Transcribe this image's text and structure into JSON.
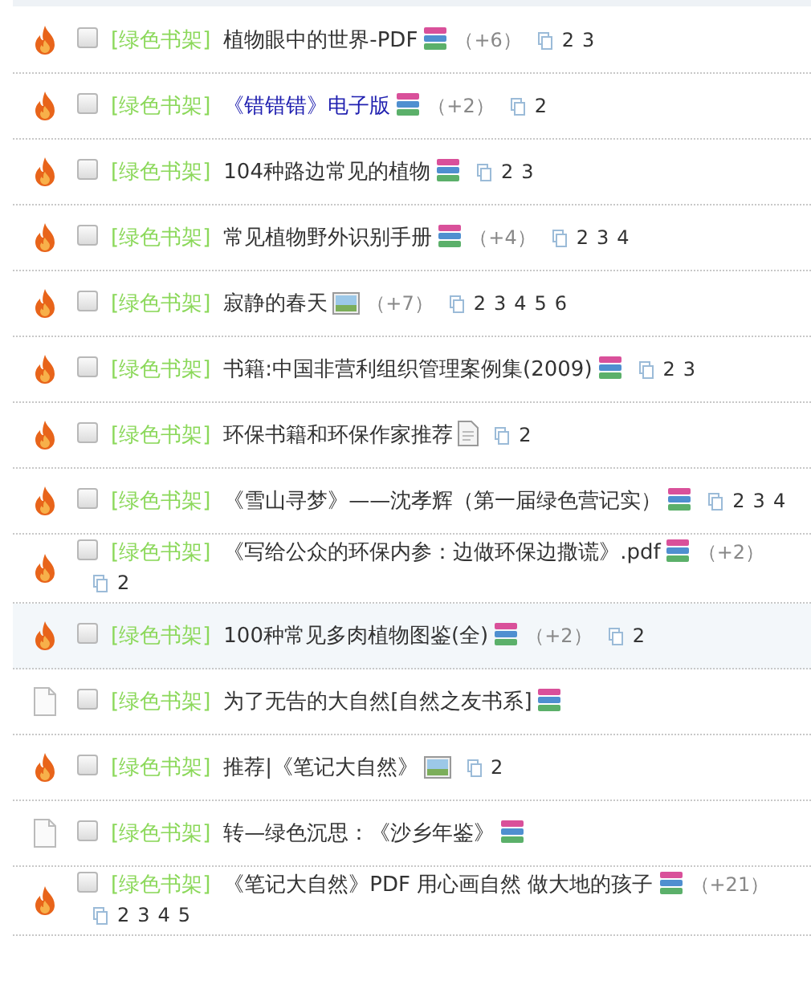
{
  "threads": [
    {
      "status": {
        "kind": "hot"
      },
      "checked": false,
      "category": "[绿色书架]",
      "title": "植物眼中的世界-PDF",
      "visited": false,
      "highlighted": false,
      "attachment": {
        "kind": "archive"
      },
      "extra": "（+6）",
      "pages": [
        "2",
        "3"
      ]
    },
    {
      "status": {
        "kind": "hot"
      },
      "checked": false,
      "category": "[绿色书架]",
      "title": "《错错错》电子版",
      "visited": true,
      "highlighted": false,
      "attachment": {
        "kind": "archive"
      },
      "extra": "（+2）",
      "pages": [
        "2"
      ]
    },
    {
      "status": {
        "kind": "hot"
      },
      "checked": false,
      "category": "[绿色书架]",
      "title": "104种路边常见的植物",
      "visited": false,
      "highlighted": false,
      "attachment": {
        "kind": "archive"
      },
      "pages": [
        "2",
        "3"
      ]
    },
    {
      "status": {
        "kind": "hot"
      },
      "checked": false,
      "category": "[绿色书架]",
      "title": "常见植物野外识别手册",
      "visited": false,
      "highlighted": false,
      "attachment": {
        "kind": "archive"
      },
      "extra": "（+4）",
      "pages": [
        "2",
        "3",
        "4"
      ]
    },
    {
      "status": {
        "kind": "hot"
      },
      "checked": false,
      "category": "[绿色书架]",
      "title": "寂静的春天",
      "visited": false,
      "highlighted": false,
      "attachment": {
        "kind": "image"
      },
      "extra": "（+7）",
      "pages": [
        "2",
        "3",
        "4",
        "5",
        "6"
      ]
    },
    {
      "status": {
        "kind": "hot"
      },
      "checked": false,
      "category": "[绿色书架]",
      "title": "书籍:中国非营利组织管理案例集(2009)",
      "visited": false,
      "highlighted": false,
      "attachment": {
        "kind": "archive"
      },
      "pages": [
        "2",
        "3"
      ]
    },
    {
      "status": {
        "kind": "hot"
      },
      "checked": false,
      "category": "[绿色书架]",
      "title": "环保书籍和环保作家推荐",
      "visited": false,
      "highlighted": false,
      "attachment": {
        "kind": "document"
      },
      "pages": [
        "2"
      ]
    },
    {
      "status": {
        "kind": "hot"
      },
      "checked": false,
      "category": "[绿色书架]",
      "title": "《雪山寻梦》——沈孝辉（第一届绿色营记实）",
      "visited": false,
      "highlighted": false,
      "attachment": {
        "kind": "archive"
      },
      "pages": [
        "2",
        "3",
        "4"
      ]
    },
    {
      "status": {
        "kind": "hot"
      },
      "checked": false,
      "category": "[绿色书架]",
      "title": "《写给公众的环保内参：边做环保边撒谎》.pdf",
      "visited": false,
      "highlighted": false,
      "attachment": {
        "kind": "archive"
      },
      "extra": "（+2）",
      "pages": [
        "2"
      ]
    },
    {
      "status": {
        "kind": "hot"
      },
      "checked": false,
      "category": "[绿色书架]",
      "title": "100种常见多肉植物图鉴(全)",
      "visited": false,
      "highlighted": true,
      "attachment": {
        "kind": "archive"
      },
      "extra": "（+2）",
      "pages": [
        "2"
      ]
    },
    {
      "status": {
        "kind": "normal"
      },
      "checked": false,
      "category": "[绿色书架]",
      "title": "为了无告的大自然[自然之友书系]",
      "visited": false,
      "highlighted": false,
      "attachment": {
        "kind": "archive"
      }
    },
    {
      "status": {
        "kind": "hot"
      },
      "checked": false,
      "category": "[绿色书架]",
      "title": "推荐|《笔记大自然》",
      "visited": false,
      "highlighted": false,
      "attachment": {
        "kind": "image"
      },
      "pages": [
        "2"
      ]
    },
    {
      "status": {
        "kind": "normal"
      },
      "checked": false,
      "category": "[绿色书架]",
      "title": "转—绿色沉思：《沙乡年鉴》",
      "visited": false,
      "highlighted": false,
      "attachment": {
        "kind": "archive"
      }
    },
    {
      "status": {
        "kind": "hot"
      },
      "checked": false,
      "category": "[绿色书架]",
      "title": "《笔记大自然》PDF  用心画自然 做大地的孩子",
      "visited": false,
      "highlighted": false,
      "attachment": {
        "kind": "archive"
      },
      "extra": "（+21）",
      "pages": [
        "2",
        "3",
        "4",
        "5"
      ]
    }
  ]
}
